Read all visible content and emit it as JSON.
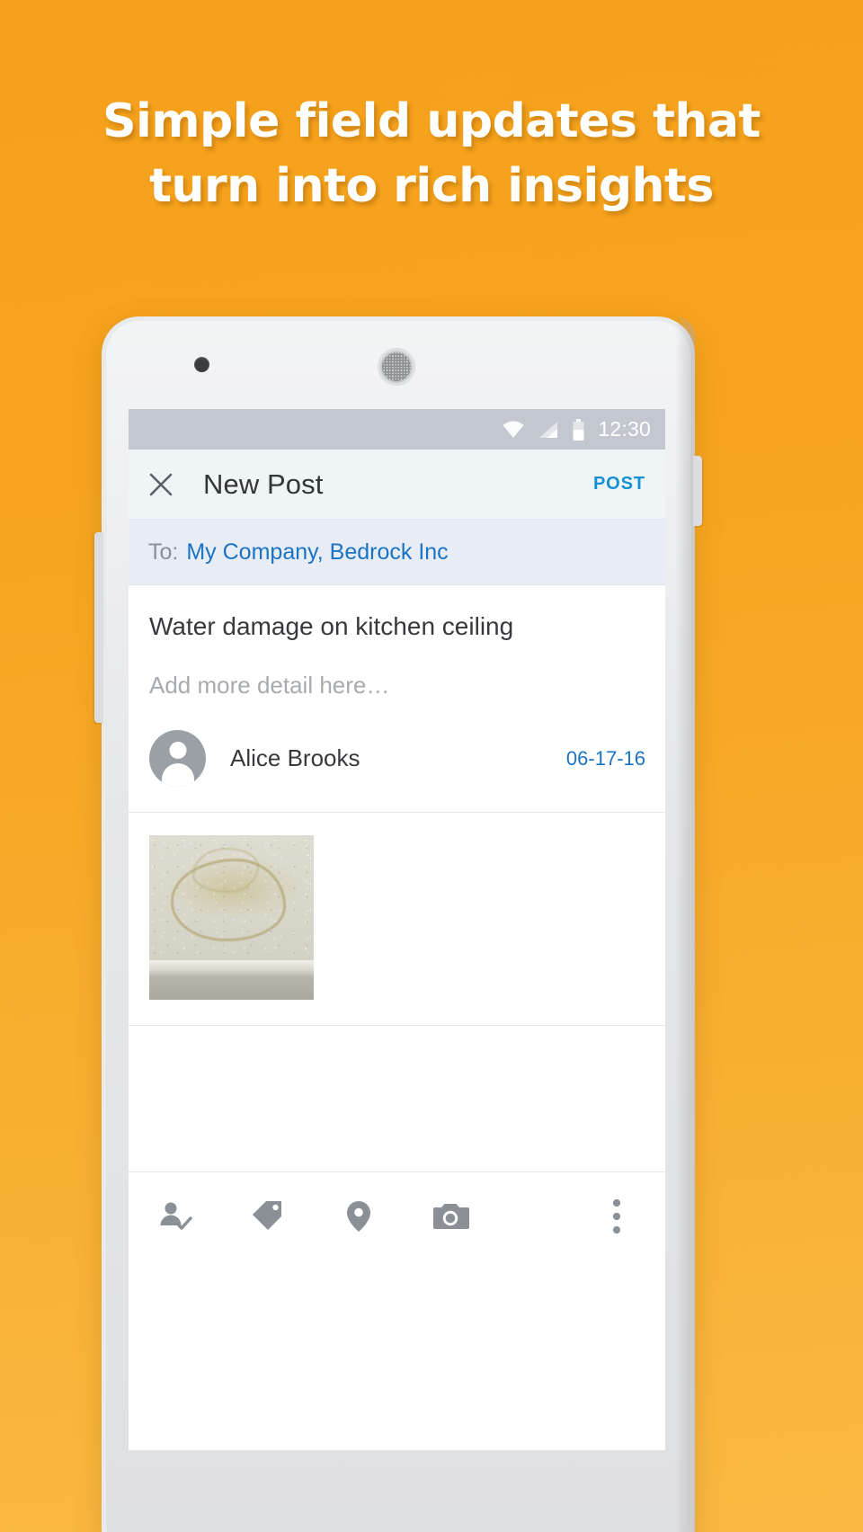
{
  "headline": {
    "line1": "Simple field updates that",
    "line2": "turn into rich insights"
  },
  "colors": {
    "background_top": "#f5a01a",
    "background_bottom": "#f9b942",
    "accent_link": "#1a73c4",
    "accent_action": "#1590d6",
    "statusbar": "#c3c7cf",
    "appbar": "#eff4f7",
    "torow": "#e8edf5",
    "icon_gray": "#8a9096"
  },
  "phone": {
    "front_camera": "front-camera-dot",
    "earpiece": "earpiece-speaker",
    "power_button": "power-button",
    "volume_button": "volume-rocker"
  },
  "statusbar": {
    "time": "12:30",
    "icons": [
      "wifi-icon",
      "signal-icon",
      "battery-icon"
    ]
  },
  "appbar": {
    "close_icon": "close-icon",
    "title": "New Post",
    "post_label": "POST"
  },
  "recipients": {
    "label": "To:",
    "value": "My Company, Bedrock Inc"
  },
  "post": {
    "title_value": "Water damage on kitchen ceiling",
    "detail_placeholder": "Add more detail here…",
    "author": "Alice Brooks",
    "date": "06-17-16",
    "avatar": "person-avatar",
    "attachment": "ceiling-water-stain-photo"
  },
  "toolbar": {
    "items": [
      {
        "name": "assign-person-icon",
        "label": "Assign"
      },
      {
        "name": "tag-icon",
        "label": "Tag"
      },
      {
        "name": "location-pin-icon",
        "label": "Location"
      },
      {
        "name": "camera-icon",
        "label": "Camera"
      },
      {
        "name": "overflow-menu-icon",
        "label": "More"
      }
    ]
  }
}
